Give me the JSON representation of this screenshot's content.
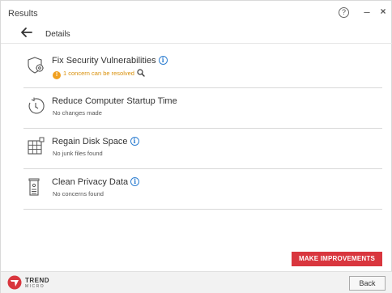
{
  "window": {
    "title": "Results"
  },
  "titlebar": {
    "help_label": "?",
    "minimize_label": "–",
    "close_label": "×"
  },
  "subheader": {
    "label": "Details"
  },
  "items": [
    {
      "name": "Fix Security Vulnerabilities",
      "status": "1 concern can be resolved",
      "status_type": "warning",
      "icon": "shield-gear-icon",
      "has_info": true
    },
    {
      "name": "Reduce Computer Startup Time",
      "status": "No changes made",
      "icon": "stopwatch-icon",
      "has_info": false
    },
    {
      "name": "Regain Disk Space",
      "status": "No junk files found",
      "icon": "disk-grid-icon",
      "has_info": true
    },
    {
      "name": "Clean Privacy Data",
      "status": "No concerns found",
      "icon": "privacy-document-icon",
      "has_info": true
    }
  ],
  "actions": {
    "make_improvements_label": "MAKE IMPROVEMENTS"
  },
  "footer": {
    "logo_line1": "TREND",
    "logo_line2": "MICRO",
    "back_label": "Back"
  },
  "colors": {
    "accent": "#d9363e",
    "info": "#2f7fd1",
    "warning": "#f0a020"
  }
}
